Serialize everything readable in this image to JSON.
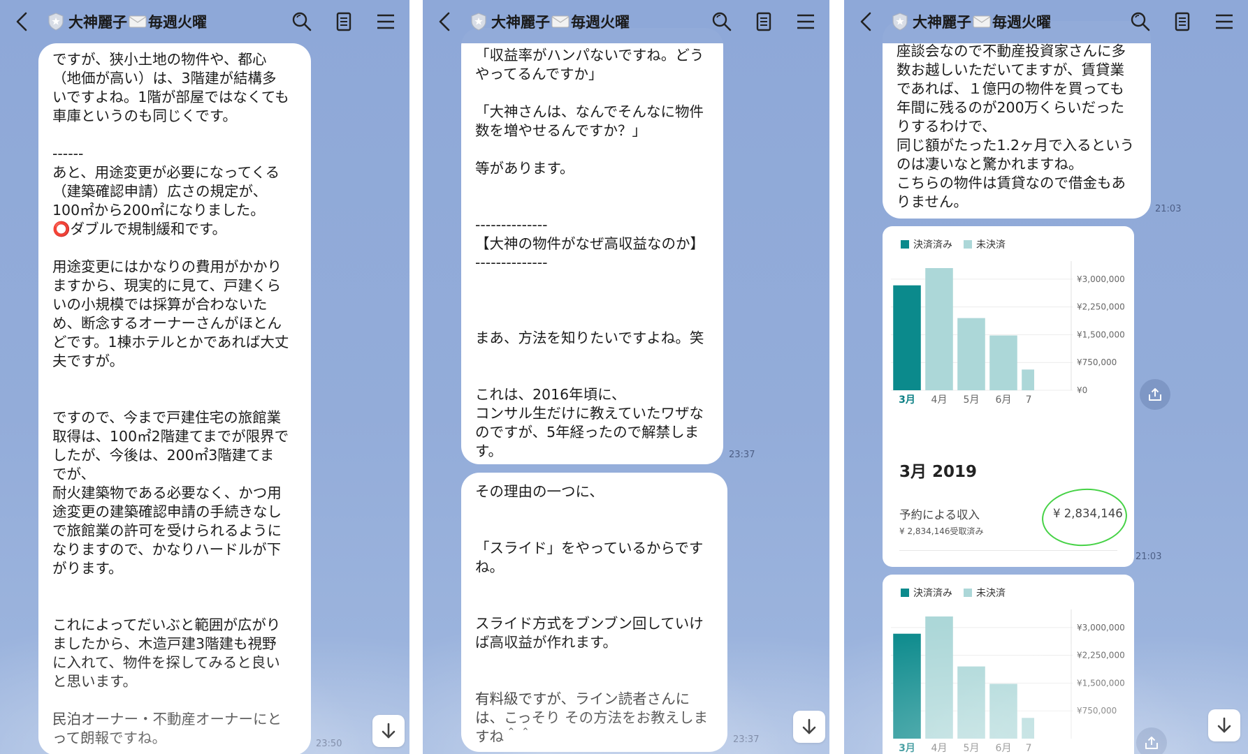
{
  "header": {
    "title_left": "大神麗子",
    "title_right": "毎週火曜"
  },
  "panel1": {
    "message": "ですが、狭小土地の物件や、都心\n（地価が高い）は、3階建が結構多\nいですよね。1階が部屋ではなくても\n車庫というのも同じくです。\n\n------\nあと、用途変更が必要になってくる\n（建築確認申請）広さの規定が、\n100㎡から200㎡になりました。\n⭕ダブルで規制緩和です。\n\n用途変更にはかなりの費用がかかり\nますから、現実的に見て、戸建くら\nいの小規模では採算が合わないた\nめ、断念するオーナーさんがほとん\nどです。1棟ホテルとかであれば大丈\n夫ですが。\n\n\nですので、今まで戸建住宅の旅館業\n取得は、100㎡2階建てまでが限界で\nしたが、今後は、200㎡3階建てま\nでが、\n耐火建築物である必要なく、かつ用\n途変更の建築確認申請の手続きなし\nで旅館業の許可を受けられるように\nなりますので、かなりハードルが下\nがります。\n\n\nこれによってだいぶと範囲が広がり\nましたから、木造戸建3階建も視野\nに入れて、物件を探してみると良い\nと思います。\n\n民泊オーナー・不動産オーナーにと\nって朗報ですね。",
    "time": "23:50"
  },
  "panel2": {
    "message1": "「収益率がハンパないですね。どう\nやってるんですか」\n\n「大神さんは、なんでそんなに物件\n数を増やせるんですか？」\n\n等があります。\n\n\n--------------\n【大神の物件がなぜ高収益なのか】\n--------------\n\n\n\nまあ、方法を知りたいですよね。笑\n\n\nこれは、2016年頃に、\nコンサル生だけに教えていたワザな\nのですが、5年経ったので解禁しま\nす。",
    "time1": "23:37",
    "message2": "その理由の一つに、\n\n\n「スライド」をやっているからです\nね。\n\n\nスライド方式をブンブン回していけ\nば高収益が作れます。\n\n\n有料級ですが、ライン読者さんに\nは、こっそり その方法をお教えしま\nすね＾＾",
    "time2": "23:37"
  },
  "panel3": {
    "message": "座談会なので不動産投資家さんに多\n数お越しいただいてますが、賃貸業\nであれば、１億円の物件を買っても\n年間に残るのが200万くらいだった\nりするわけで、\n同じ額がたった1.2ヶ月で入るという\nのは凄いなと驚かれますね。\nこちらの物件は賃貸なので借金もあ\nりません。",
    "time1": "21:03",
    "time2": "21:03",
    "card": {
      "legend_settled": "決済済み",
      "legend_unsettled": "未決済",
      "period": "3月 2019",
      "income_label": "予約による収入",
      "income_value": "¥ 2,834,146",
      "income_sub": "¥ 2,834,146受取済み"
    },
    "card2": {
      "legend_settled": "決済済み",
      "legend_unsettled": "未決済"
    }
  },
  "colors": {
    "settled": "#0b8a8c",
    "unsettled": "#acd7d8",
    "background": "#8ea8d8"
  },
  "chart_data": [
    {
      "type": "bar",
      "categories": [
        "3月",
        "4月",
        "5月",
        "6月",
        "7"
      ],
      "series": [
        {
          "name": "決済済み",
          "values": [
            2834146,
            0,
            0,
            0,
            0
          ]
        },
        {
          "name": "未決済",
          "values": [
            0,
            3300000,
            1950000,
            1480000,
            560000
          ]
        }
      ],
      "ytick_labels": [
        "¥3,000,000",
        "¥2,250,000",
        "¥1,500,000",
        "¥750,000",
        "¥0"
      ],
      "yticks": [
        3000000,
        2250000,
        1500000,
        750000,
        0
      ],
      "ylim": [
        0,
        3300000
      ],
      "legend": "top-left"
    },
    {
      "type": "bar",
      "categories": [
        "3月",
        "4月",
        "5月",
        "6月",
        "7"
      ],
      "series": [
        {
          "name": "決済済み",
          "values": [
            2834146,
            0,
            0,
            0,
            0
          ]
        },
        {
          "name": "未決済",
          "values": [
            0,
            3300000,
            1950000,
            1480000,
            560000
          ]
        }
      ],
      "ytick_labels": [
        "¥3,000,000",
        "¥2,250,000",
        "¥1,500,000",
        "¥750,000"
      ],
      "yticks": [
        3000000,
        2250000,
        1500000,
        750000
      ],
      "ylim": [
        0,
        3300000
      ],
      "legend": "top-left"
    }
  ]
}
